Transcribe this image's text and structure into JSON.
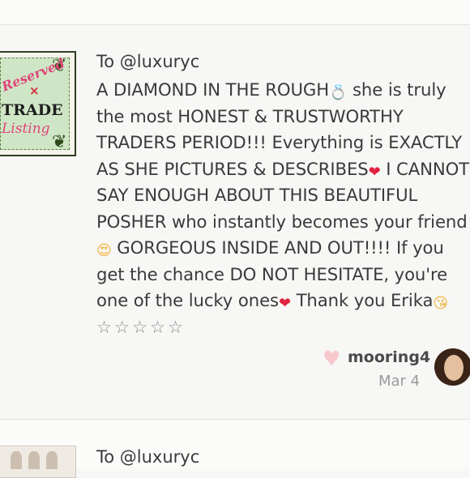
{
  "review1": {
    "to_line": "To @luxuryc",
    "listing_thumb": {
      "icon": "reserved-trade-listing-image",
      "reserved_text": "Reserved",
      "x_mark": "×",
      "trade_text": "TRADE",
      "listing_text": "Listing"
    },
    "segments": {
      "s1": "A DIAMOND IN THE ROUGH",
      "s2": " she is truly the most HONEST & TRUSTWORTHY TRADERS PERIOD!!! Everything is EXACTLY AS SHE PICTURES & DESCRIBES",
      "s3": " I CANNOT SAY ENOUGH ABOUT THIS BEAUTIFUL POSHER who instantly becomes your friend",
      "s4": " GORGEOUS INSIDE AND OUT!!!! If you get the chance DO NOT HESITATE, you're one of the lucky ones",
      "s5": " Thank you Erika"
    },
    "emoji": {
      "diamond": "💍",
      "heart": "❤",
      "heart_eyes": "😍",
      "kiss": "😘"
    },
    "stars": "☆☆☆☆☆",
    "like_icon": "♥",
    "username": "mooring4",
    "date": "Mar 4"
  },
  "review2": {
    "to_line": "To @luxuryc"
  },
  "colors": {
    "heart_red": "#e3233f",
    "like_heart": "#f6c7cc",
    "text": "#3a3a3a",
    "muted": "#9a9a9a"
  }
}
